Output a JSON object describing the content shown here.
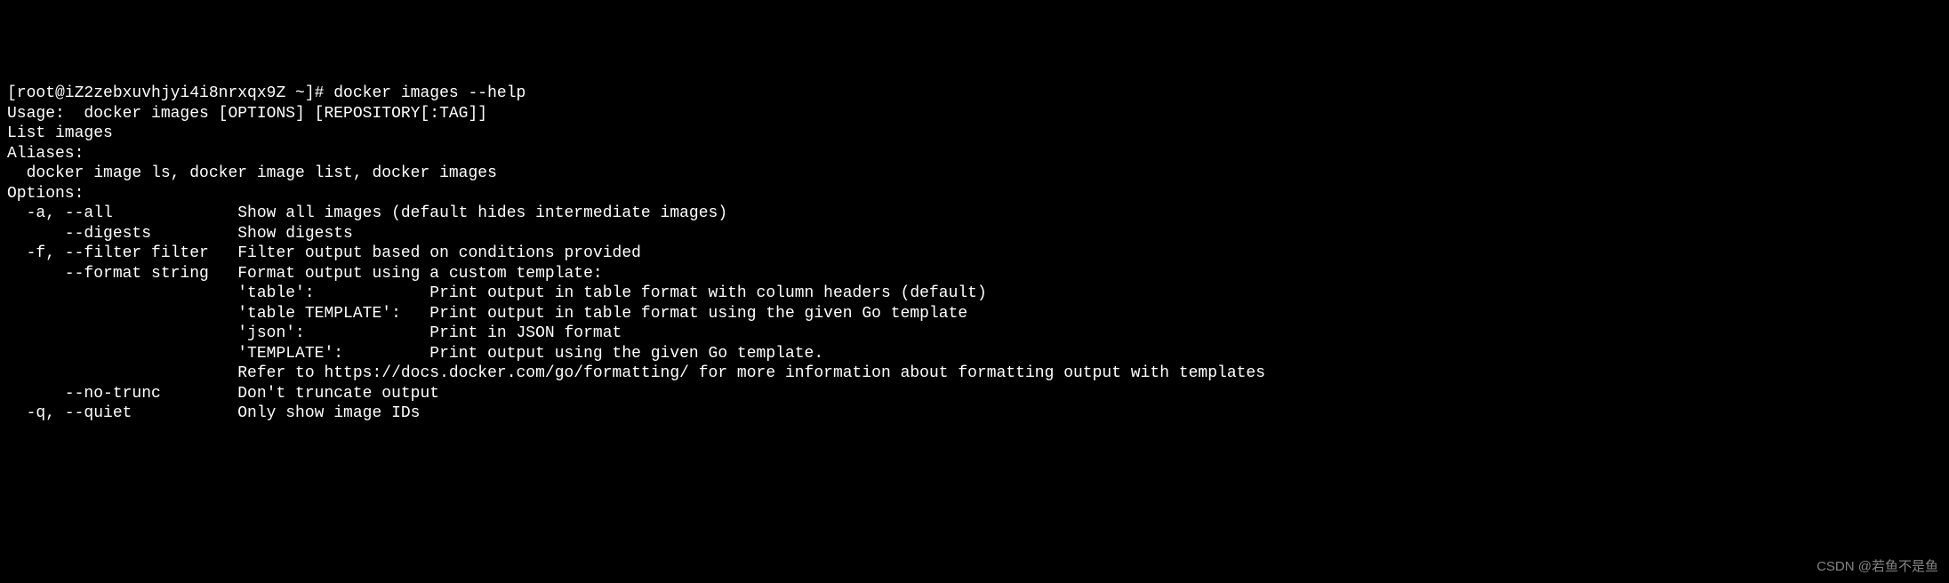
{
  "terminal": {
    "prompt_line": "[root@iZ2zebxuvhjyi4i8nrxqx9Z ~]# docker images --help",
    "blank1": "",
    "usage_line": "Usage:  docker images [OPTIONS] [REPOSITORY[:TAG]]",
    "blank2": "",
    "list_images": "List images",
    "blank3": "",
    "aliases_header": "Aliases:",
    "aliases_line": "  docker image ls, docker image list, docker images",
    "blank4": "",
    "options_header": "Options:",
    "opt_all": "  -a, --all             Show all images (default hides intermediate images)",
    "opt_digests": "      --digests         Show digests",
    "opt_filter": "  -f, --filter filter   Filter output based on conditions provided",
    "opt_format": "      --format string   Format output using a custom template:",
    "opt_format_table": "                        'table':            Print output in table format with column headers (default)",
    "opt_format_table_tmpl": "                        'table TEMPLATE':   Print output in table format using the given Go template",
    "opt_format_json": "                        'json':             Print in JSON format",
    "opt_format_tmpl": "                        'TEMPLATE':         Print output using the given Go template.",
    "opt_format_refer": "                        Refer to https://docs.docker.com/go/formatting/ for more information about formatting output with templates",
    "opt_notrunc": "      --no-trunc        Don't truncate output",
    "opt_quiet": "  -q, --quiet           Only show image IDs"
  },
  "watermark": "CSDN @若鱼不是鱼"
}
